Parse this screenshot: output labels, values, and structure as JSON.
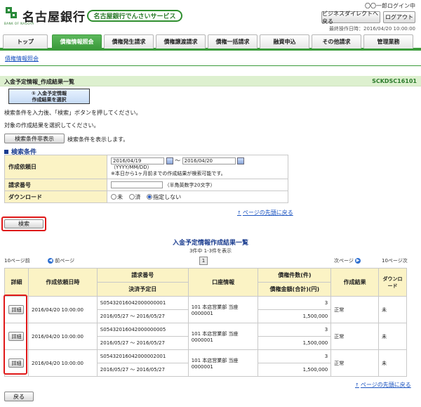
{
  "header": {
    "bank_name": "名古屋銀行",
    "bank_logo_sub": "BANK OF NAGOYA",
    "service_name": "名古屋銀行でんさいサービス",
    "user_name": "〇〇一郎ログイン中",
    "bizdirect_button": "ビジネスダイレクトへ戻る",
    "logout_button": "ログアウト",
    "last_operation": "最終操作日時：2016/04/20 10:00:00"
  },
  "tabs": [
    {
      "label": "トップ"
    },
    {
      "label": "債権情報照会"
    },
    {
      "label": "債権発生請求"
    },
    {
      "label": "債権譲渡請求"
    },
    {
      "label": "債権一括請求"
    },
    {
      "label": "融資申込"
    },
    {
      "label": "その他請求"
    },
    {
      "label": "管理業務"
    }
  ],
  "subnav": {
    "link": "債権情報照会"
  },
  "page": {
    "title": "入金予定情報_作成結果一覧",
    "screen_id": "SCKDSC16101",
    "step_line1": "① 入金予定情報",
    "step_line2": "作成結果を選択",
    "instruction1": "検索条件を入力後、「検索」ボタンを押してください。",
    "instruction2": "対象の作成結果を選択してください。",
    "toggle_button": "検索条件非表示",
    "toggle_note": "検索条件を表示します。"
  },
  "search": {
    "heading": "検索条件",
    "creation_date_label": "作成依頼日",
    "date_from": "2016/04/19",
    "date_sep": "～",
    "date_to": "2016/04/20",
    "date_format": "（YYYY/MM/DD）",
    "date_note": "※本日から1ヶ月前までの作成結果が検索可能です。",
    "request_no_label": "請求番号",
    "request_no_value": "",
    "request_no_note": "（半角英数字20文字）",
    "download_label": "ダウンロード",
    "radio_options": [
      "未",
      "済",
      "指定しない"
    ],
    "top_link": "ページの先頭に戻る",
    "search_button": "検索"
  },
  "results": {
    "title": "入金予定情報作成結果一覧",
    "count": "3件中 1-3件を表示",
    "prev10": "10ページ前",
    "prev": "前ページ",
    "page": "1",
    "next": "次ページ",
    "next10": "10ページ次",
    "headers": {
      "detail": "詳細",
      "created_at": "作成依頼日時",
      "request_no": "請求番号",
      "settlement_date": "決済予定日",
      "account": "口座情報",
      "count": "債権件数(件)",
      "amount": "債権金額(合計)(円)",
      "result": "作成結果",
      "download": "ダウンロード"
    },
    "rows": [
      {
        "detail": "詳細",
        "created_at": "2016/04/20 10:00:00",
        "request_no": "S05432016042000000001",
        "settlement": "2016/05/27 ～ 2016/05/27",
        "account": "101 本店営業部 当座 0000001",
        "count": "3",
        "amount": "1,500,000",
        "result": "正常",
        "download": "未"
      },
      {
        "detail": "詳細",
        "created_at": "2016/04/20 10:00:00",
        "request_no": "S05432016042000000005",
        "settlement": "2016/05/27 ～ 2016/05/27",
        "account": "101 本店営業部 当座 0000001",
        "count": "3",
        "amount": "1,500,000",
        "result": "正常",
        "download": "未"
      },
      {
        "detail": "詳細",
        "created_at": "2016/04/20 10:00:00",
        "request_no": "S05432016042000002001",
        "settlement": "2016/05/27 ～ 2016/05/27",
        "account": "101 本店営業部 当座 0000001",
        "count": "3",
        "amount": "1,500,000",
        "result": "正常",
        "download": "未"
      }
    ],
    "top_link": "ページの先頭に戻る"
  },
  "footer": {
    "back_button": "戻る"
  },
  "colors": {
    "accent_green": "#3b9b3b",
    "title_bg": "#ddf0cf",
    "label_bg": "#fbf3c5",
    "highlight": "#e01818"
  }
}
